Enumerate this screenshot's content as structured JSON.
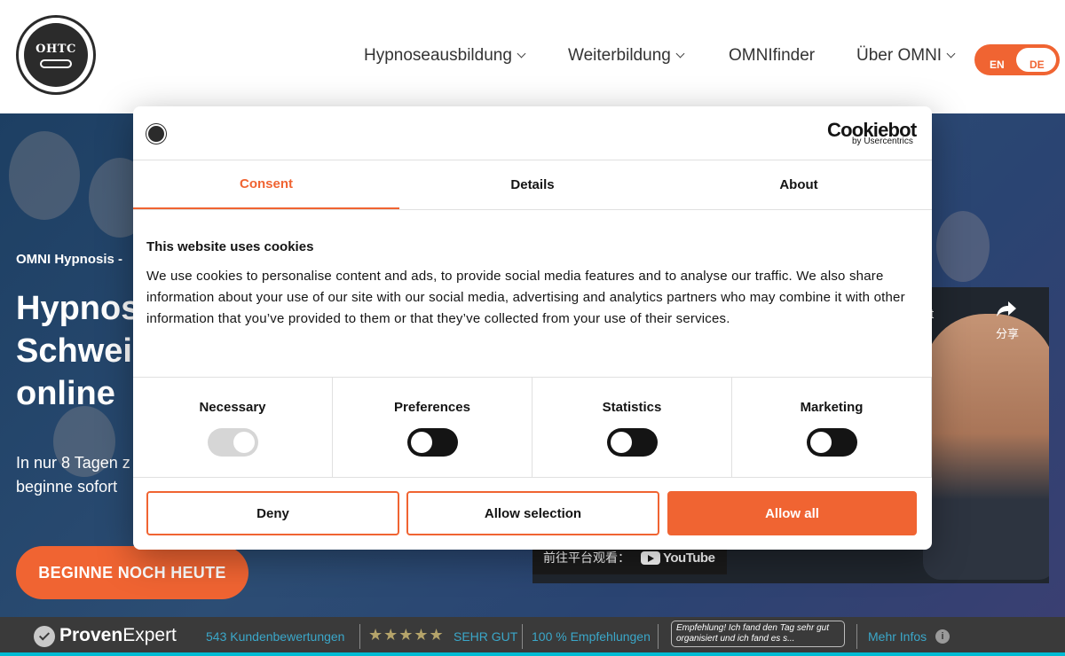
{
  "header": {
    "logo_text": "OHTC",
    "nav": [
      {
        "label": "Hypnoseausbildung",
        "has_dropdown": true
      },
      {
        "label": "Weiterbildung",
        "has_dropdown": true
      },
      {
        "label": "OMNIfinder",
        "has_dropdown": false
      },
      {
        "label": "Über OMNI",
        "has_dropdown": true
      }
    ],
    "lang": {
      "en": "EN",
      "de": "DE",
      "active": "DE"
    }
  },
  "hero": {
    "subtitle": "OMNI Hypnosis -",
    "title_lines": [
      "Hypnos",
      "Schweiz",
      "online"
    ],
    "text_lines": [
      "In nur 8 Tagen z",
      "beginne sofort"
    ],
    "cta": "BEGINNE NOCH HEUTE",
    "video": {
      "title_fragment": "t",
      "share_label": "分享",
      "watch_label": "前往平台观看：",
      "platform": "YouTube"
    }
  },
  "proven_expert": {
    "brand_bold": "Proven",
    "brand_regular": "Expert",
    "reviews": "543 Kundenbewertungen",
    "stars": "★★★★★",
    "rating": "SEHR GUT",
    "recommend": "100 % Empfehlungen",
    "quote": "Empfehlung! Ich fand den Tag sehr gut organisiert und ich fand es s...",
    "more": "Mehr Infos",
    "info_icon": "i"
  },
  "cookie_dialog": {
    "brand": "Cookiebot",
    "brand_sub": "by Usercentrics",
    "tabs": [
      "Consent",
      "Details",
      "About"
    ],
    "active_tab": "Consent",
    "heading": "This website uses cookies",
    "body": "We use cookies to personalise content and ads, to provide social media features and to analyse our traffic. We also share information about your use of our site with our social media, advertising and analytics partners who may combine it with other information that you’ve provided to them or that they’ve collected from your use of their services.",
    "categories": [
      {
        "label": "Necessary",
        "state": "on",
        "disabled": true
      },
      {
        "label": "Preferences",
        "state": "off",
        "disabled": false
      },
      {
        "label": "Statistics",
        "state": "off",
        "disabled": false
      },
      {
        "label": "Marketing",
        "state": "off",
        "disabled": false
      }
    ],
    "buttons": {
      "deny": "Deny",
      "allow_selection": "Allow selection",
      "allow_all": "Allow all"
    }
  },
  "colors": {
    "accent": "#f06432",
    "hero_bg": "#2c4d74",
    "bar_bg": "#3a3a3a",
    "bar_text": "#3aa7c9"
  },
  "icons": [
    "chevron-down-icon",
    "share-icon",
    "youtube-logo",
    "check-badge-icon",
    "info-icon",
    "omni-logo"
  ]
}
